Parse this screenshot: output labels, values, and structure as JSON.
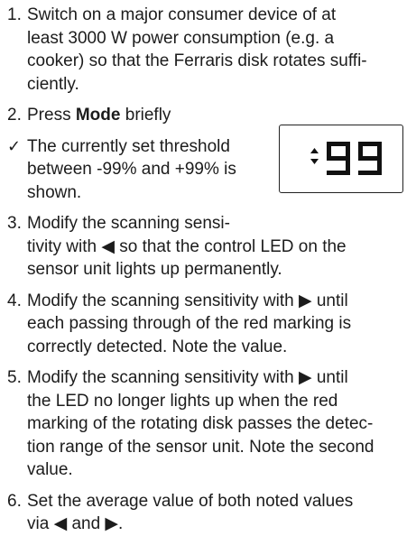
{
  "steps": [
    {
      "num": "1.",
      "lines": [
        "Switch on a major consumer device of at",
        "least 3000 W power consumption (e.g. a",
        "cooker) so that the Ferraris disk rotates suffi-",
        "ciently."
      ]
    },
    {
      "num": "2.",
      "pre": "Press ",
      "bold": "Mode",
      "post": " briefly"
    },
    {
      "check": "✓",
      "lines": [
        "The currently set threshold",
        "between -99% and +99% is",
        "shown."
      ]
    },
    {
      "num": "3.",
      "lines": [
        "Modify the scanning sensi-"
      ],
      "cont_lines": [
        "tivity with ◀ so that the control LED on the",
        "sensor unit lights up permanently."
      ]
    },
    {
      "num": "4.",
      "lines": [
        "Modify the scanning sensitivity with ▶ until",
        "each passing through of the red marking is",
        "correctly detected. Note the value."
      ]
    },
    {
      "num": "5.",
      "lines": [
        "Modify the scanning sensitivity with ▶ until",
        "the LED no longer lights up when the red",
        "marking of the rotating disk passes the detec-",
        "tion range of the sensor unit. Note the second",
        "value."
      ]
    },
    {
      "num": "6.",
      "lines": [
        "Set the average value of both noted values",
        "via ◀ and ▶."
      ]
    }
  ],
  "display": {
    "symbol": "up-down-arrows-icon",
    "value": "99"
  }
}
